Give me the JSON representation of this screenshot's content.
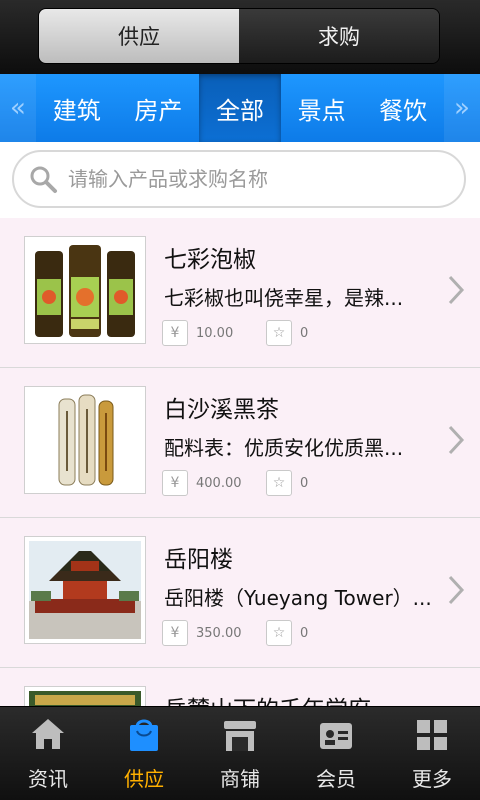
{
  "segments": {
    "left": "供应",
    "right": "求购"
  },
  "categories": {
    "prev_arrow": "«",
    "next_arrow": "»",
    "items": [
      "建筑",
      "房产",
      "全部",
      "景点",
      "餐饮"
    ],
    "active": "全部"
  },
  "search": {
    "placeholder": "请输入产品或求购名称"
  },
  "products": [
    {
      "title": "七彩泡椒",
      "desc": "七彩椒也叫侥幸星，是辣...",
      "price": "10.00",
      "favorites": "0"
    },
    {
      "title": " 白沙溪黑茶",
      "desc": "配料表：优质安化优质黑...",
      "price": "400.00",
      "favorites": "0"
    },
    {
      "title": "岳阳楼",
      "desc": "岳阳楼（Yueyang Tower）...",
      "price": "350.00",
      "favorites": "0"
    },
    {
      "title": "岳麓山下的千年学府",
      "desc": "",
      "price": "",
      "favorites": ""
    }
  ],
  "tabbar": {
    "items": [
      "资讯",
      "供应",
      "商铺",
      "会员",
      "更多"
    ],
    "active": "供应"
  },
  "colors": {
    "accent_blue": "#0d7be8",
    "active_tab": "#ffb000"
  }
}
